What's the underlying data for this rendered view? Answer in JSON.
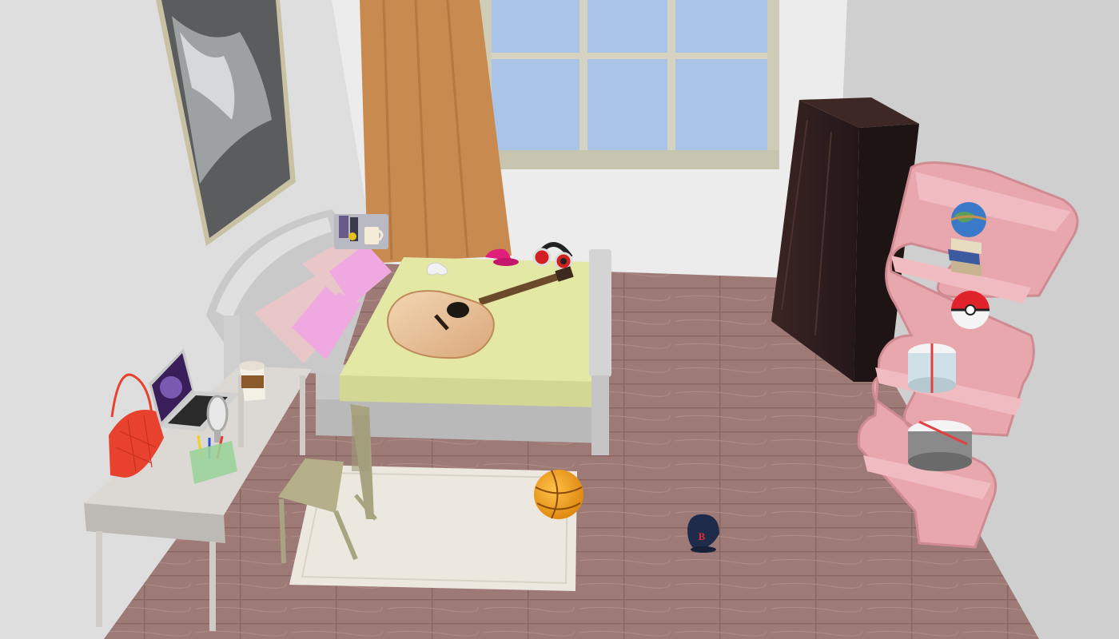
{
  "scene": {
    "type": "3d-room-view",
    "room": "bedroom",
    "objects": [
      {
        "name": "wall-painting",
        "kind": "painting"
      },
      {
        "name": "window",
        "kind": "window"
      },
      {
        "name": "curtain",
        "kind": "curtain"
      },
      {
        "name": "bed",
        "kind": "bed"
      },
      {
        "name": "pillows",
        "kind": "pillow"
      },
      {
        "name": "acoustic-guitar",
        "kind": "guitar"
      },
      {
        "name": "headphones",
        "kind": "headphones"
      },
      {
        "name": "pink-cap",
        "kind": "cap"
      },
      {
        "name": "game-controller",
        "kind": "controller"
      },
      {
        "name": "nightstand-mug",
        "kind": "mug"
      },
      {
        "name": "wardrobe",
        "kind": "wardrobe"
      },
      {
        "name": "wave-bookshelf",
        "kind": "shelf"
      },
      {
        "name": "globe",
        "kind": "globe"
      },
      {
        "name": "book-stack",
        "kind": "books"
      },
      {
        "name": "pokeball",
        "kind": "ball"
      },
      {
        "name": "gift-box-top",
        "kind": "box"
      },
      {
        "name": "gift-box-bottom",
        "kind": "box"
      },
      {
        "name": "desk",
        "kind": "desk"
      },
      {
        "name": "laptop",
        "kind": "laptop"
      },
      {
        "name": "red-handbag",
        "kind": "handbag"
      },
      {
        "name": "coffee-cup",
        "kind": "cup"
      },
      {
        "name": "pencil-holder",
        "kind": "organizer"
      },
      {
        "name": "desk-mirror",
        "kind": "mirror"
      },
      {
        "name": "desk-chair",
        "kind": "chair"
      },
      {
        "name": "area-rug",
        "kind": "rug"
      },
      {
        "name": "basketball",
        "kind": "ball"
      },
      {
        "name": "baseball-cap",
        "kind": "cap"
      }
    ]
  },
  "colors": {
    "floor": "#9e7a77",
    "wall_left": "#dcdcdc",
    "wall_back": "#ececec",
    "wall_right": "#cfcfcf",
    "wardrobe": "#2e1d1b",
    "shelf": "#e8a6ad",
    "bedsheet": "#e3e8a4",
    "curtain": "#c98a4f",
    "window_glass": "#a9c4e6",
    "rug": "#ece8df",
    "desk": "#dcd8d4",
    "handbag": "#e8422f",
    "basketball": "#f0a020",
    "cap_navy": "#1f2b4a",
    "pink_cap": "#e01f7a"
  },
  "labels": {
    "cap_letter": "B"
  }
}
